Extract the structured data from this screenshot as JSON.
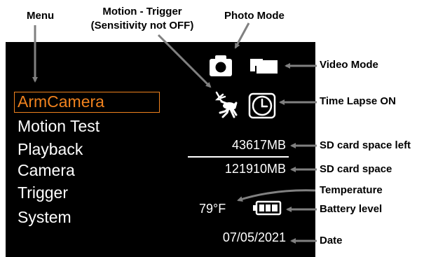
{
  "annotations": {
    "menu": "Menu",
    "motion_trigger_line1": "Motion - Trigger",
    "motion_trigger_line2": "(Sensitivity not OFF)",
    "photo_mode": "Photo Mode",
    "video_mode": "Video Mode",
    "time_lapse": "Time Lapse ON",
    "sd_left": "SD card space left",
    "sd_total": "SD card space",
    "temperature": "Temperature",
    "battery": "Battery level",
    "date": "Date"
  },
  "screen": {
    "menu_items": [
      {
        "label": "ArmCamera",
        "selected": true
      },
      {
        "label": "Motion Test",
        "selected": false
      },
      {
        "label": "Playback",
        "selected": false
      },
      {
        "label": "Camera",
        "selected": false
      },
      {
        "label": "Trigger",
        "selected": false
      },
      {
        "label": "System",
        "selected": false
      }
    ],
    "sd_space_left": "43617MB",
    "sd_space_total": "121910MB",
    "temperature": "79°F",
    "battery_level": 1.0,
    "date": "07/05/2021",
    "icons": [
      "camera-icon",
      "video-camera-icon",
      "deer-icon",
      "clock-icon",
      "battery-icon"
    ]
  },
  "colors": {
    "screen_bg": "#000000",
    "selected": "#f0821e",
    "text": "#ffffff"
  }
}
